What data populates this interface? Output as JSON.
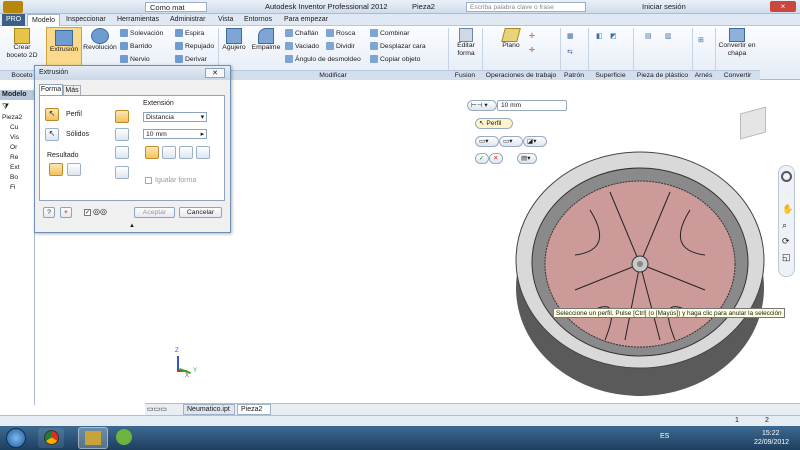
{
  "titlebar": {
    "app_title": "Autodesk Inventor Professional 2012",
    "doc": "Pieza2",
    "search_placeholder": "Escriba palabra clave o frase",
    "sign_in": "Iniciar sesión",
    "quick_combo": "Como mat"
  },
  "menubar": {
    "pro": "PRO",
    "items": [
      "Modelo",
      "Inspeccionar",
      "Herramientas",
      "Administrar",
      "Vista",
      "Entornos",
      "Para empezar"
    ]
  },
  "ribbon": {
    "boceto": {
      "label": "Crear\nboceto 2D",
      "panel": "Boceto"
    },
    "crear": {
      "extrusion": "Extrusión",
      "revolucion": "Revolución",
      "solevacion": "Solevación",
      "barrido": "Barrido",
      "nervio": "Nervio",
      "espira": "Espira",
      "repujado": "Repujado",
      "derivar": "Derivar"
    },
    "modificar": {
      "agujero": "Agujero",
      "empalme": "Empalme",
      "chaflan": "Chaflán",
      "vaciado": "Vaciado",
      "angulo": "Ángulo de desmoldeo",
      "rosca": "Rosca",
      "dividir": "Dividir",
      "combinar": "Combinar",
      "desplazar": "Desplazar cara",
      "copiar": "Copiar objeto",
      "panel": "Modificar"
    },
    "editar_forma": "Editar\nforma",
    "fusion": "Fusion",
    "plano": "Plano",
    "operaciones": "Operaciones de trabajo",
    "patron": "Patrón",
    "superficie": "Superficie",
    "pieza_plastico": "Pieza de plástico",
    "arnes": "Arnés",
    "convertir": "Convertir en\nchapa",
    "convertir_panel": "Convertir"
  },
  "browser": {
    "title": "Modelo",
    "items": [
      "Pieza2",
      "Cu",
      "Vis",
      "Or",
      "Re",
      "Ext",
      "Bo",
      "Fi"
    ]
  },
  "dialog": {
    "title": "Extrusión",
    "tab_forma": "Forma",
    "tab_mas": "Más",
    "perfil": "Perfil",
    "solidos": "Sólidos",
    "resultado": "Resultado",
    "extension": "Extensión",
    "distance_type": "Distancia",
    "distance_value": "10 mm",
    "igualar": "Igualar forma",
    "aceptar": "Aceptar",
    "cancelar": "Cancelar"
  },
  "mini_toolbar": {
    "value": "10 mm",
    "perfil": "Perfil"
  },
  "tooltip": "Seleccione un perfil. Pulse [Ctrl] (o [Mayús]) y haga clic para anular la selección",
  "axis": {
    "x": "X",
    "y": "Y",
    "z": "Z"
  },
  "doc_tabs": [
    "Neumatico.ipt",
    "Pieza2"
  ],
  "statusbar": {
    "right_a": "1",
    "right_b": "2"
  },
  "taskbar": {
    "lang": "ES",
    "time": "15:22",
    "date": "22/09/2012"
  }
}
